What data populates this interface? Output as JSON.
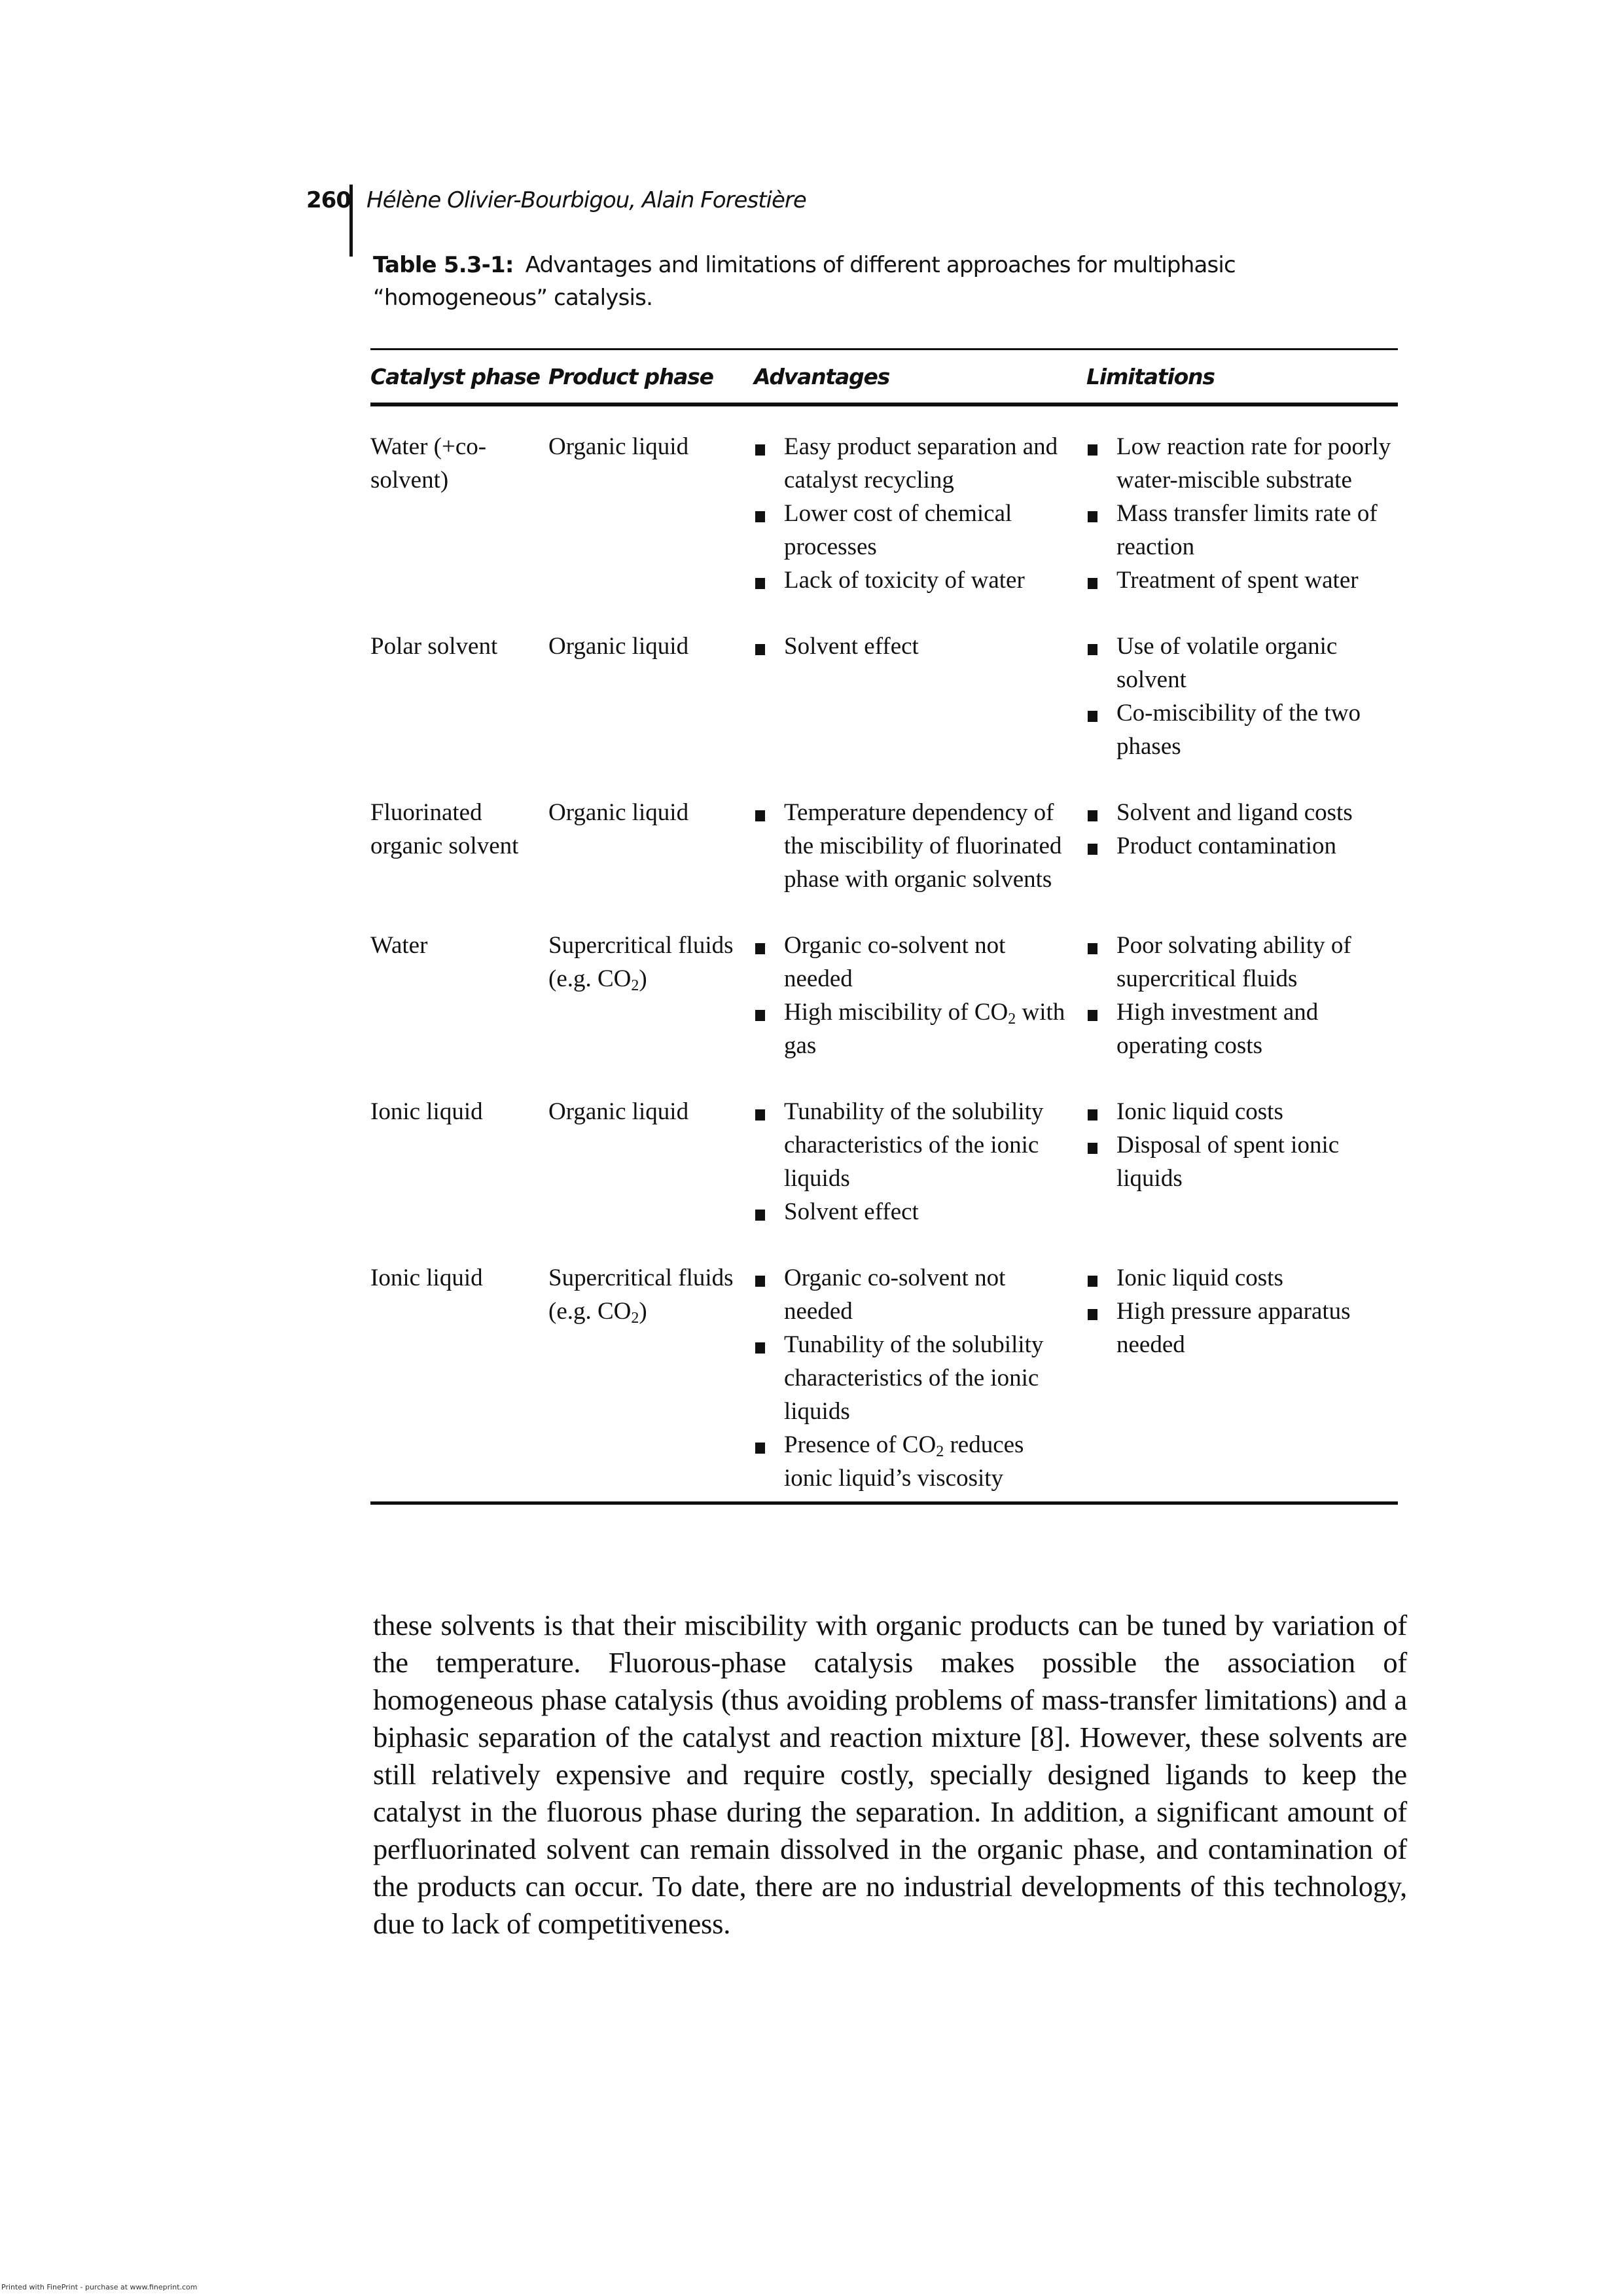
{
  "running_head": {
    "page_number": "260",
    "authors": "Hélène Olivier-Bourbigou, Alain Forestière"
  },
  "caption": {
    "label": "Table 5.3-1:",
    "text": "Advantages and limitations of different approaches for multiphasic “homogeneous” catalysis."
  },
  "table": {
    "headers": [
      "Catalyst phase",
      "Product phase",
      "Advantages",
      "Limitations"
    ],
    "rows": [
      {
        "catalyst_phase": "Water (+co-solvent)",
        "product_phase": "Organic liquid",
        "advantages": [
          "Easy product separation and  catalyst recycling",
          "Lower cost of chemical processes",
          "Lack of toxicity of water"
        ],
        "limitations": [
          "Low reaction rate for poorly water-miscible substrate",
          "Mass transfer limits rate of reaction",
          "Treatment of spent water"
        ]
      },
      {
        "catalyst_phase": "Polar solvent",
        "product_phase": "Organic liquid",
        "advantages": [
          "Solvent effect"
        ],
        "limitations": [
          "Use of volatile organic solvent",
          "Co-miscibility of the two phases"
        ]
      },
      {
        "catalyst_phase": "Fluorinated organic solvent",
        "product_phase": "Organic liquid",
        "advantages": [
          "Temperature dependency of the miscibility of fluorinated phase with organic solvents"
        ],
        "limitations": [
          "Solvent and ligand costs",
          "Product contamination"
        ]
      },
      {
        "catalyst_phase": "Water",
        "product_phase": "Supercritical fluids (e.g. CO₂)",
        "advantages": [
          "Organic co-solvent not needed",
          "High miscibility of CO₂ with gas"
        ],
        "limitations": [
          "Poor solvating ability of supercritical fluids",
          "High investment and operating costs"
        ]
      },
      {
        "catalyst_phase": "Ionic liquid",
        "product_phase": "Organic liquid",
        "advantages": [
          "Tunability of the solubility characteristics of the ionic liquids",
          "Solvent effect"
        ],
        "limitations": [
          "Ionic liquid costs",
          "Disposal of spent ionic liquids"
        ]
      },
      {
        "catalyst_phase": "Ionic liquid",
        "product_phase": "Supercritical fluids (e.g. CO₂)",
        "advantages": [
          "Organic co-solvent not needed",
          "Tunability of the solubility characteristics of the ionic liquids",
          "Presence of CO₂ reduces ionic liquid’s viscosity"
        ],
        "limitations": [
          "Ionic liquid costs",
          "High pressure apparatus needed"
        ]
      }
    ]
  },
  "body_text": "these solvents is that their miscibility with organic products can be tuned by variation of the temperature. Fluorous-phase catalysis makes possible the association of homogeneous phase catalysis (thus avoiding problems of mass-transfer limitations) and a biphasic separation of the catalyst and reaction mixture [8]. However, these solvents are still relatively expensive and require costly, specially designed ligands to keep the catalyst in the fluorous phase during the separation. In addition, a significant amount of perfluorinated solvent can remain dissolved in the organic phase, and contamination of the products can occur. To date, there are no industrial developments of this technology, due to lack of competitiveness.",
  "footer_note": "Printed with FinePrint - purchase at www.fineprint.com"
}
